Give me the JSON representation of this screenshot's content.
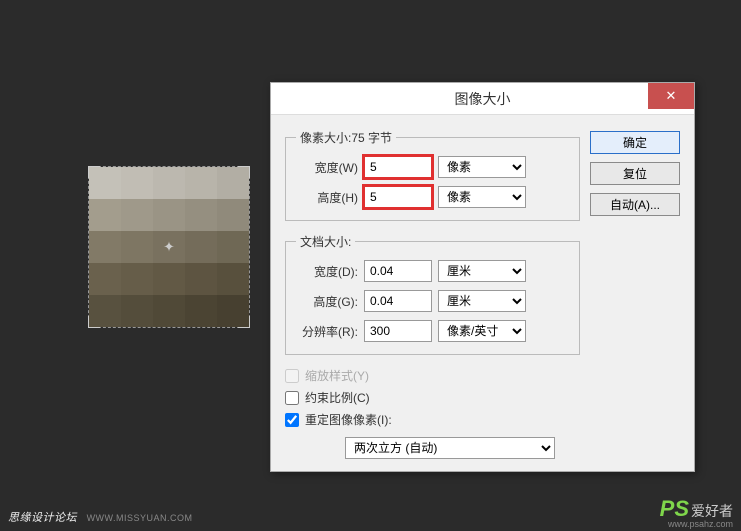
{
  "dialog": {
    "title": "图像大小",
    "close": "✕",
    "buttons": {
      "ok": "确定",
      "reset": "复位",
      "auto": "自动(A)..."
    },
    "pixel_group": {
      "legend": "像素大小:75 字节",
      "width_label": "宽度(W)",
      "width_value": "5",
      "height_label": "高度(H)",
      "height_value": "5",
      "unit": "像素"
    },
    "doc_group": {
      "legend": "文档大小:",
      "width_label": "宽度(D):",
      "width_value": "0.04",
      "width_unit": "厘米",
      "height_label": "高度(G):",
      "height_value": "0.04",
      "height_unit": "厘米",
      "res_label": "分辨率(R):",
      "res_value": "300",
      "res_unit": "像素/英寸"
    },
    "checks": {
      "scale_styles": "缩放样式(Y)",
      "constrain": "约束比例(C)",
      "resample": "重定图像像素(I):"
    },
    "resample_method": "两次立方 (自动)"
  },
  "swatches": [
    "#c4c1b8",
    "#c1bdb4",
    "#bcb8af",
    "#b8b4aa",
    "#b2aea4",
    "#a39d8d",
    "#9f998a",
    "#9a9485",
    "#958f80",
    "#908a7b",
    "#827a67",
    "#7e7663",
    "#79715f",
    "#746c5a",
    "#6f6855",
    "#6a614d",
    "#665d49",
    "#625945",
    "#5d5441",
    "#58503d",
    "#58513f",
    "#544d3b",
    "#504937",
    "#4b4433",
    "#474030"
  ],
  "watermark": {
    "left_main": "思缘设计论坛",
    "left_sub": "WWW.MISSYUAN.COM",
    "right_ps": "PS",
    "right_cn": "爱好者",
    "right_url": "www.psahz.com"
  }
}
